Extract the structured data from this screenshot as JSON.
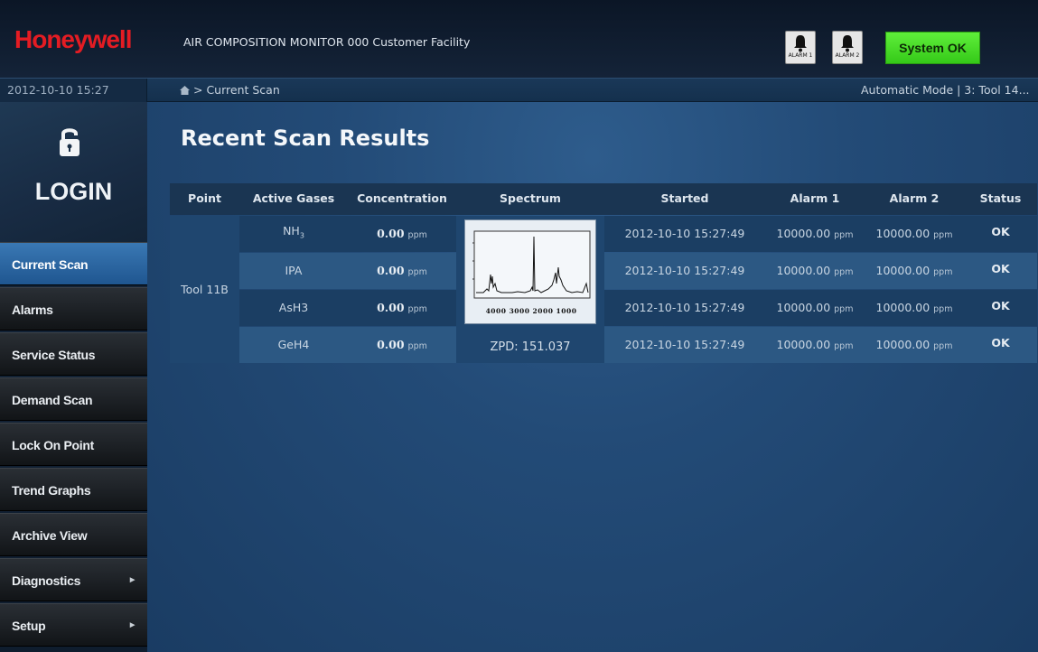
{
  "header": {
    "logo": "Honeywell",
    "title": "AIR COMPOSITION MONITOR 000 Customer Facility",
    "alarm1_label": "ALARM 1",
    "alarm2_label": "ALARM 2",
    "system_status": "System OK"
  },
  "statusbar": {
    "datetime": "2012-10-10 15:27",
    "breadcrumb": "> Current Scan",
    "mode": "Automatic Mode | 3: Tool 14..."
  },
  "sidebar": {
    "login_label": "LOGIN",
    "items": [
      {
        "label": "Current Scan",
        "active": true
      },
      {
        "label": "Alarms"
      },
      {
        "label": "Service Status"
      },
      {
        "label": "Demand Scan"
      },
      {
        "label": "Lock On Point"
      },
      {
        "label": "Trend Graphs"
      },
      {
        "label": "Archive View"
      },
      {
        "label": "Diagnostics",
        "submenu": true
      },
      {
        "label": "Setup",
        "submenu": true
      }
    ]
  },
  "main": {
    "title": "Recent Scan Results",
    "columns": [
      "Point",
      "Active Gases",
      "Concentration",
      "Spectrum",
      "Started",
      "Alarm 1",
      "Alarm 2",
      "Status"
    ],
    "point": "Tool 11B",
    "zpd": "ZPD: 151.037",
    "spectrum_ticks": "4000 3000 2000 1000",
    "unit": "ppm",
    "rows": [
      {
        "gas": "NH",
        "gas_sub": "3",
        "conc": "0.00",
        "started": "2012-10-10 15:27:49",
        "alarm1": "10000.00",
        "alarm2": "10000.00",
        "status": "OK"
      },
      {
        "gas": "IPA",
        "gas_sub": "",
        "conc": "0.00",
        "started": "2012-10-10 15:27:49",
        "alarm1": "10000.00",
        "alarm2": "10000.00",
        "status": "OK"
      },
      {
        "gas": "AsH3",
        "gas_sub": "",
        "conc": "0.00",
        "started": "2012-10-10 15:27:49",
        "alarm1": "10000.00",
        "alarm2": "10000.00",
        "status": "OK"
      },
      {
        "gas": "GeH4",
        "gas_sub": "",
        "conc": "0.00",
        "started": "2012-10-10 15:27:49",
        "alarm1": "10000.00",
        "alarm2": "10000.00",
        "status": "OK"
      }
    ]
  },
  "colors": {
    "brand_red": "#e41c23",
    "status_ok_green": "#4fe02c",
    "nav_active_blue": "#2f6aa6"
  }
}
